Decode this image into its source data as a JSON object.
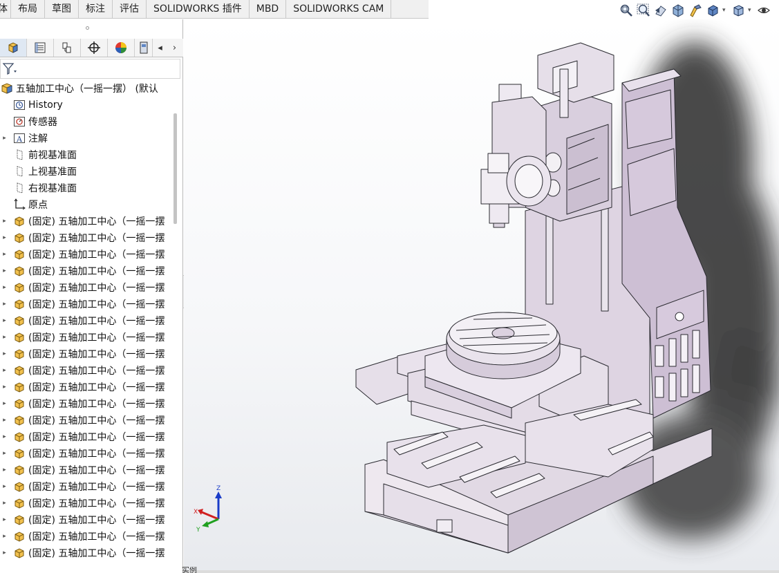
{
  "tabs": [
    "体",
    "布局",
    "草图",
    "标注",
    "评估",
    "SOLIDWORKS 插件",
    "MBD",
    "SOLIDWORKS CAM"
  ],
  "hud_icons": [
    "zoom-to-fit-icon",
    "zoom-to-area-icon",
    "previous-view-icon",
    "section-view-icon",
    "dynamic-annotation-icon",
    "display-style-icon",
    "view-orientation-icon",
    "hide-show-icon"
  ],
  "manager_tabs": [
    "featuremanager-icon",
    "propertymanager-icon",
    "configurationmanager-icon",
    "dimxpert-icon",
    "displaymanager-icon",
    "cam-icon"
  ],
  "tree": {
    "root": "五轴加工中心（一摇一摆） (默认",
    "items": [
      {
        "label": "History",
        "icon": "history-icon",
        "expandable": false
      },
      {
        "label": "传感器",
        "icon": "sensor-icon",
        "expandable": false
      },
      {
        "label": "注解",
        "icon": "annotation-icon",
        "expandable": true
      },
      {
        "label": "前视基准面",
        "icon": "plane-icon",
        "expandable": false
      },
      {
        "label": "上视基准面",
        "icon": "plane-icon",
        "expandable": false
      },
      {
        "label": "右视基准面",
        "icon": "plane-icon",
        "expandable": false
      },
      {
        "label": "原点",
        "icon": "origin-icon",
        "expandable": false
      }
    ],
    "component_label": "(固定) 五轴加工中心（一摇一摆",
    "component_count": 21
  },
  "triad": {
    "x": "X",
    "y": "Y",
    "z": "Z"
  },
  "bottom_tab": "实例"
}
